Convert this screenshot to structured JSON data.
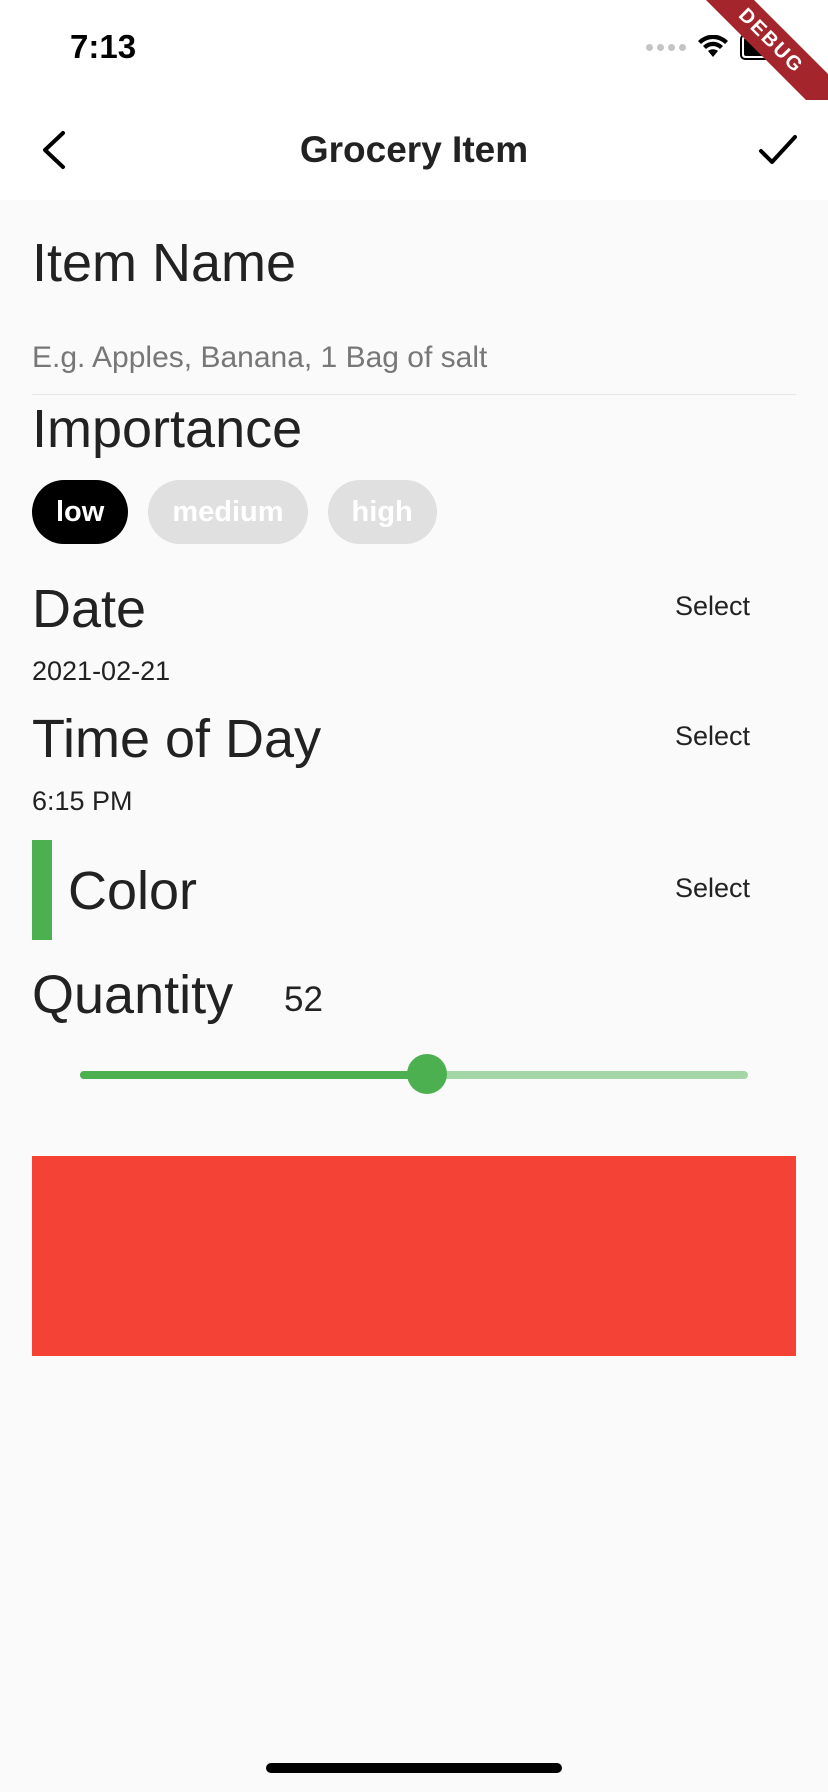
{
  "status_bar": {
    "time": "7:13",
    "debug_label": "DEBUG"
  },
  "app_bar": {
    "title": "Grocery Item",
    "back_icon": "chevron-left-icon",
    "save_icon": "check-icon"
  },
  "item_name": {
    "label": "Item Name",
    "placeholder": "E.g. Apples, Banana, 1 Bag of salt",
    "value": ""
  },
  "importance": {
    "label": "Importance",
    "options": [
      {
        "label": "low",
        "selected": true
      },
      {
        "label": "medium",
        "selected": false
      },
      {
        "label": "high",
        "selected": false
      }
    ]
  },
  "date": {
    "label": "Date",
    "value": "2021-02-21",
    "select_label": "Select"
  },
  "time_of_day": {
    "label": "Time of Day",
    "value": "6:15 PM",
    "select_label": "Select"
  },
  "color": {
    "label": "Color",
    "value": "#4caf50",
    "select_label": "Select"
  },
  "quantity": {
    "label": "Quantity",
    "value": "52",
    "slider_fraction": 0.52
  },
  "preview": {
    "color": "#f44336"
  }
}
